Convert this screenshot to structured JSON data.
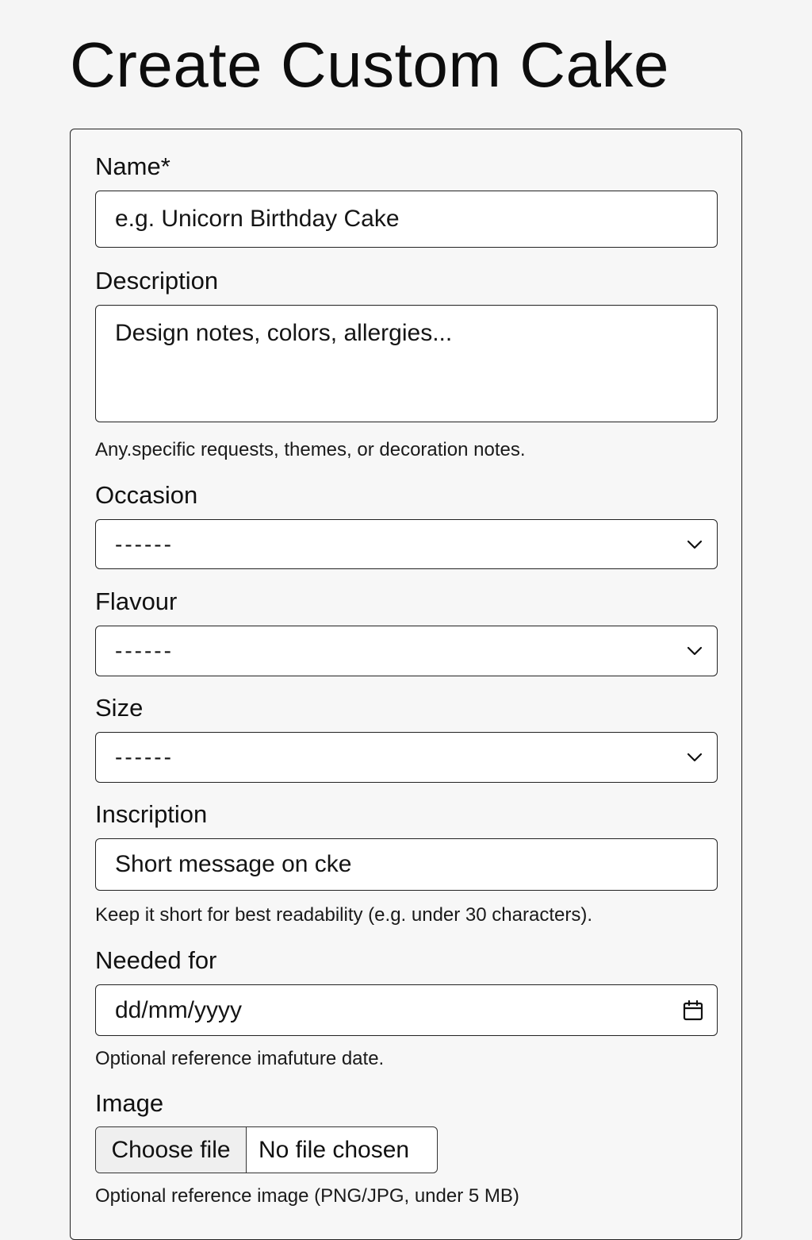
{
  "page": {
    "title": "Create Custom Cake"
  },
  "form": {
    "name": {
      "label": "Name*",
      "placeholder": "e.g. Unicorn Birthday Cake"
    },
    "description": {
      "label": "Description",
      "placeholder": "Design notes, colors, allergies...",
      "help": "Any.specific requests, themes, or decoration notes."
    },
    "occasion": {
      "label": "Occasion",
      "selected": "------",
      "icon": "chevron-down-icon"
    },
    "flavour": {
      "label": "Flavour",
      "selected": "------",
      "icon": "chevron-down-icon"
    },
    "size": {
      "label": "Size",
      "selected": "------",
      "icon": "chevron-down-icon"
    },
    "inscription": {
      "label": "Inscription",
      "placeholder": "Short message on cke",
      "help": "Keep it short for best readability (e.g. under 30 characters)."
    },
    "needed_for": {
      "label": "Needed for",
      "placeholder": "dd/mm/yyyy",
      "help": "Optional reference imafuture date.",
      "icon": "calendar-icon"
    },
    "image": {
      "label": "Image",
      "button_label": "Choose file",
      "status": "No file chosen",
      "help": "Optional reference image (PNG/JPG, under  5 MB)"
    }
  }
}
